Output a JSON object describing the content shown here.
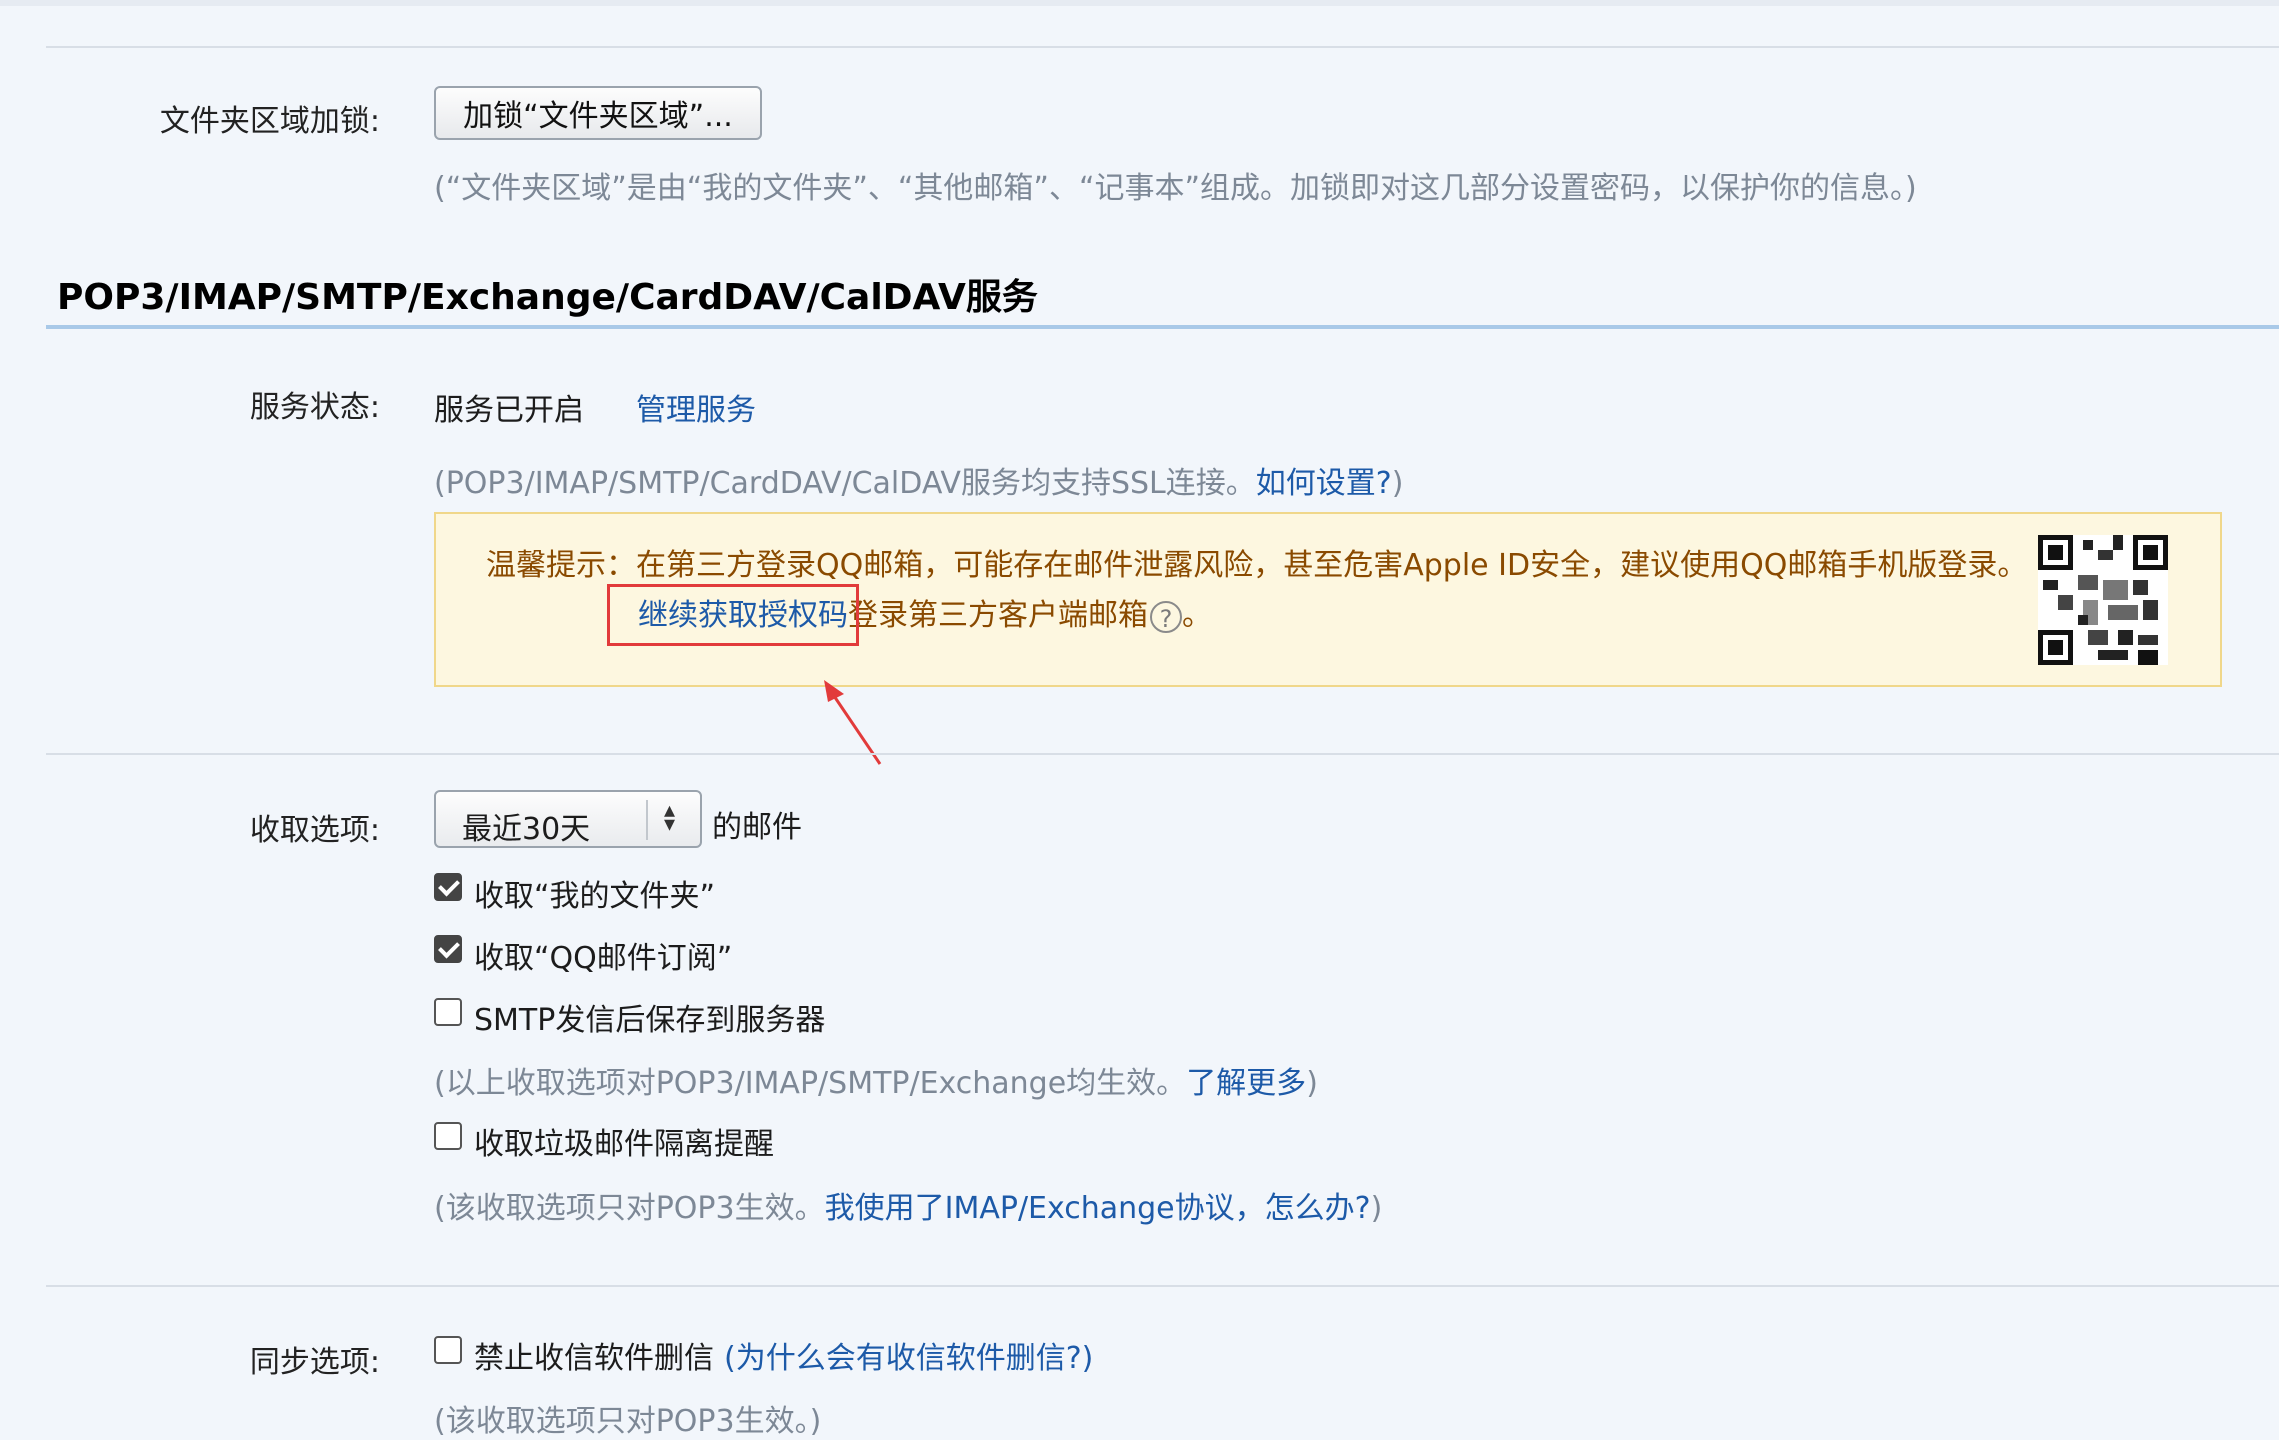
{
  "folder_lock": {
    "label": "文件夹区域加锁:",
    "button_label": "加锁“文件夹区域”...",
    "hint": "(“文件夹区域”是由“我的文件夹”、“其他邮箱”、“记事本”组成。加锁即对这几部分设置密码，以保护你的信息。)"
  },
  "section": {
    "title": "POP3/IMAP/SMTP/Exchange/CardDAV/CalDAV服务"
  },
  "service_status": {
    "label": "服务状态:",
    "value": "服务已开启",
    "manage_link": "管理服务",
    "hint_prefix": "(POP3/IMAP/SMTP/CardDAV/CalDAV服务均支持SSL连接。",
    "hint_link": "如何设置?",
    "hint_suffix": ")"
  },
  "tip": {
    "line1": "温馨提示：在第三方登录QQ邮箱，可能存在邮件泄露风险，甚至危害Apple ID安全，建议使用QQ邮箱手机版登录。",
    "auth_link": "继续获取授权码",
    "line2_suffix": "登录第三方客户端邮箱",
    "help_icon": "question-icon",
    "line2_end": "。"
  },
  "receive_options": {
    "label": "收取选项:",
    "select_value": "最近30天",
    "select_suffix": "的邮件",
    "checkboxes": [
      {
        "label": "收取“我的文件夹”",
        "checked": true
      },
      {
        "label": "收取“QQ邮件订阅”",
        "checked": true
      },
      {
        "label": "SMTP发信后保存到服务器",
        "checked": false
      }
    ],
    "hint1_prefix": "(以上收取选项对POP3/IMAP/SMTP/Exchange均生效。",
    "hint1_link": "了解更多",
    "hint1_suffix": ")",
    "spam_checkbox": {
      "label": "收取垃圾邮件隔离提醒",
      "checked": false
    },
    "hint2_prefix": "(该收取选项只对POP3生效。",
    "hint2_link": "我使用了IMAP/Exchange协议，怎么办?",
    "hint2_suffix": ")"
  },
  "sync_options": {
    "label": "同步选项:",
    "checkbox": {
      "label": "禁止收信软件删信",
      "checked": false
    },
    "checkbox_link": "(为什么会有收信软件删信?)",
    "hint": "(该收取选项只对POP3生效。)"
  }
}
